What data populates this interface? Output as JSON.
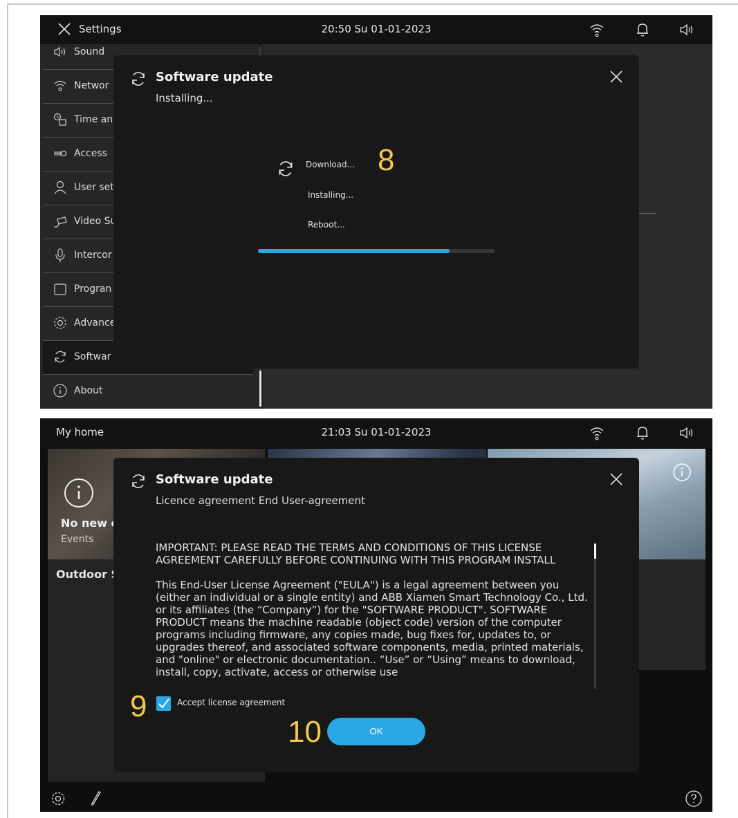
{
  "screen1": {
    "statusbar": {
      "title": "Settings",
      "clock": "20:50  Su 01-01-2023"
    },
    "sidebar": {
      "items": [
        {
          "label": "Sound",
          "icon": "speaker-icon"
        },
        {
          "label": "Networ",
          "icon": "wifi-icon"
        },
        {
          "label": "Time an",
          "icon": "clock-calendar-icon"
        },
        {
          "label": "Access",
          "icon": "key-icon"
        },
        {
          "label": "User set",
          "icon": "user-icon"
        },
        {
          "label": "Video Su",
          "icon": "camera-icon"
        },
        {
          "label": "Intercor",
          "icon": "microphone-icon"
        },
        {
          "label": "Progran",
          "icon": "square-icon"
        },
        {
          "label": "Advance",
          "icon": "gear-icon"
        },
        {
          "label": "Softwar",
          "icon": "refresh-icon"
        },
        {
          "label": "About",
          "icon": "info-icon"
        }
      ]
    },
    "dialog": {
      "title": "Software update",
      "subtitle": "Installing...",
      "steps": {
        "download": "Download...",
        "installing": "Installing...",
        "reboot": "Reboot..."
      },
      "callout": "8",
      "progress_fraction": 0.81
    }
  },
  "screen2": {
    "statusbar": {
      "title": "My home",
      "clock": "21:03  Su 01-01-2023"
    },
    "home": {
      "events_title": "No new e",
      "events_sub": "Events",
      "outdoor_title": "Outdoor S"
    },
    "dialog": {
      "title": "Software update",
      "subtitle": "Licence agreement End User-agreement",
      "license_p1": "IMPORTANT: PLEASE READ THE TERMS AND CONDITIONS OF THIS LICENSE AGREEMENT CAREFULLY BEFORE CONTINUING WITH THIS PROGRAM INSTALL",
      "license_p2": "This End-User License Agreement (\"EULA\") is a legal agreement between you (either an individual or a single entity) and ABB Xiamen Smart Technology Co., Ltd. or its affiliates (the “Company”) for the \"SOFTWARE PRODUCT\". SOFTWARE PRODUCT means the machine readable (object code) version of the computer programs including firmware, any copies made, bug fixes for, updates to, or upgrades thereof, and associated software components, media, printed materials, and \"online\" or electronic documentation.. “Use” or “Using” means to download, install, copy, activate, access or otherwise use",
      "accept_label": "Accept license agreement",
      "accept_checked": true,
      "ok_label": "OK",
      "callout_checkbox": "9",
      "callout_ok": "10"
    }
  },
  "colors": {
    "accent": "#2aa8e6",
    "callout": "#f0c850",
    "dialog_bg": "#181818"
  }
}
